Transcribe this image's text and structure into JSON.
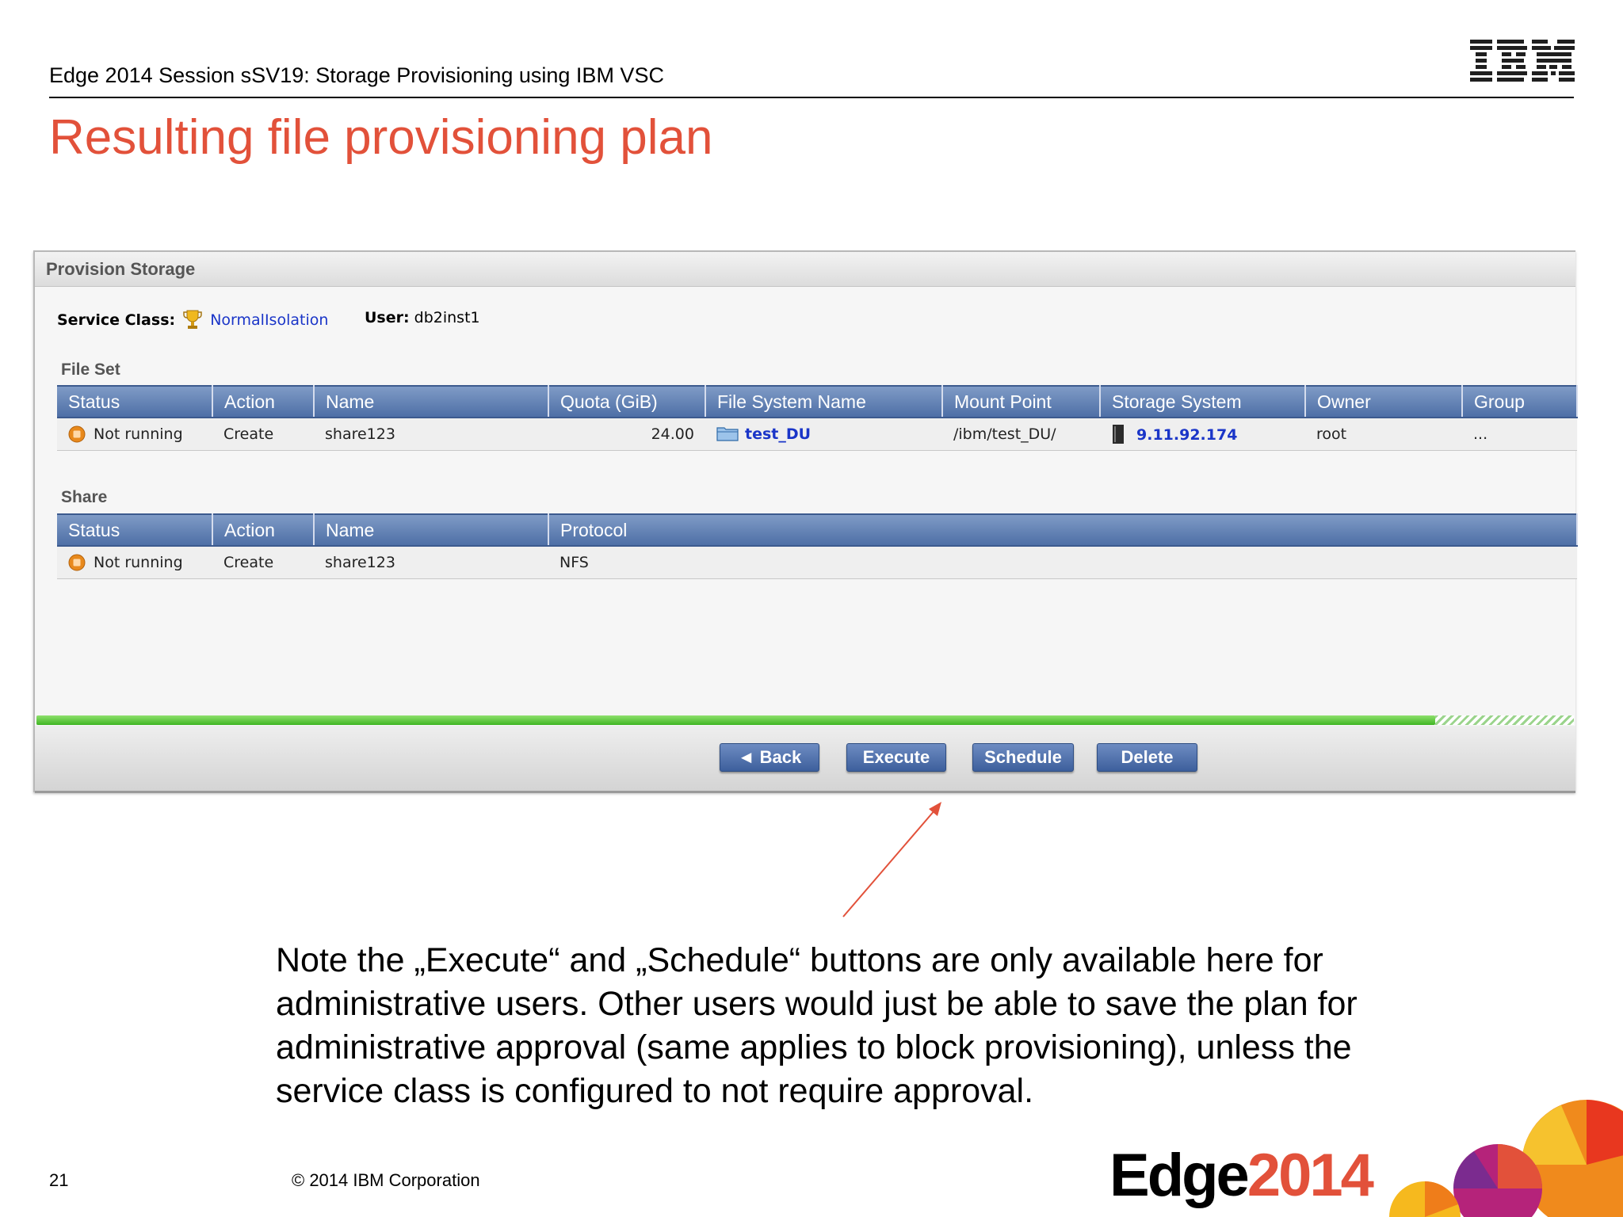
{
  "slide": {
    "header": "Edge 2014 Session sSV19: Storage Provisioning using IBM VSC",
    "logo": "IBM",
    "title": "Resulting file provisioning plan",
    "page_number": "21",
    "copyright": "© 2014 IBM Corporation",
    "brand_word": "Edge",
    "brand_year": "2014"
  },
  "panel": {
    "title": "Provision Storage",
    "service_class_label": "Service Class:",
    "service_class_value": "NormalIsolation",
    "user_label": "User:",
    "user_value": "db2inst1",
    "progress_fraction": 0.91
  },
  "fileset": {
    "label": "File Set",
    "columns": [
      "Status",
      "Action",
      "Name",
      "Quota (GiB)",
      "File System Name",
      "Mount Point",
      "Storage System",
      "Owner",
      "Group"
    ],
    "rows": [
      {
        "status": "Not running",
        "action": "Create",
        "name": "share123",
        "quota": "24.00",
        "fs_name": "test_DU",
        "mount_point": "/ibm/test_DU/",
        "storage_system": "9.11.92.174",
        "owner": "root",
        "group": "..."
      }
    ]
  },
  "share": {
    "label": "Share",
    "columns": [
      "Status",
      "Action",
      "Name",
      "Protocol"
    ],
    "rows": [
      {
        "status": "Not running",
        "action": "Create",
        "name": "share123",
        "protocol": "NFS"
      }
    ]
  },
  "buttons": {
    "back": "◄ Back",
    "execute": "Execute",
    "schedule": "Schedule",
    "delete": "Delete"
  },
  "note": "Note the „Execute“ and „Schedule“ buttons are only available here for administrative users. Other users would just be able to save the plan for administrative approval (same applies to block provisioning), unless the service class is configured to not require approval.",
  "colors": {
    "title_red": "#e2513a",
    "header_blue": "#4e6fa6",
    "link_blue": "#1a35c8",
    "progress_green": "#3fb523",
    "status_orange": "#e8891c"
  },
  "icons": {
    "service_class": "trophy-icon",
    "status": "status-stopped-icon",
    "file_system": "folder-icon",
    "storage_system": "server-icon"
  }
}
